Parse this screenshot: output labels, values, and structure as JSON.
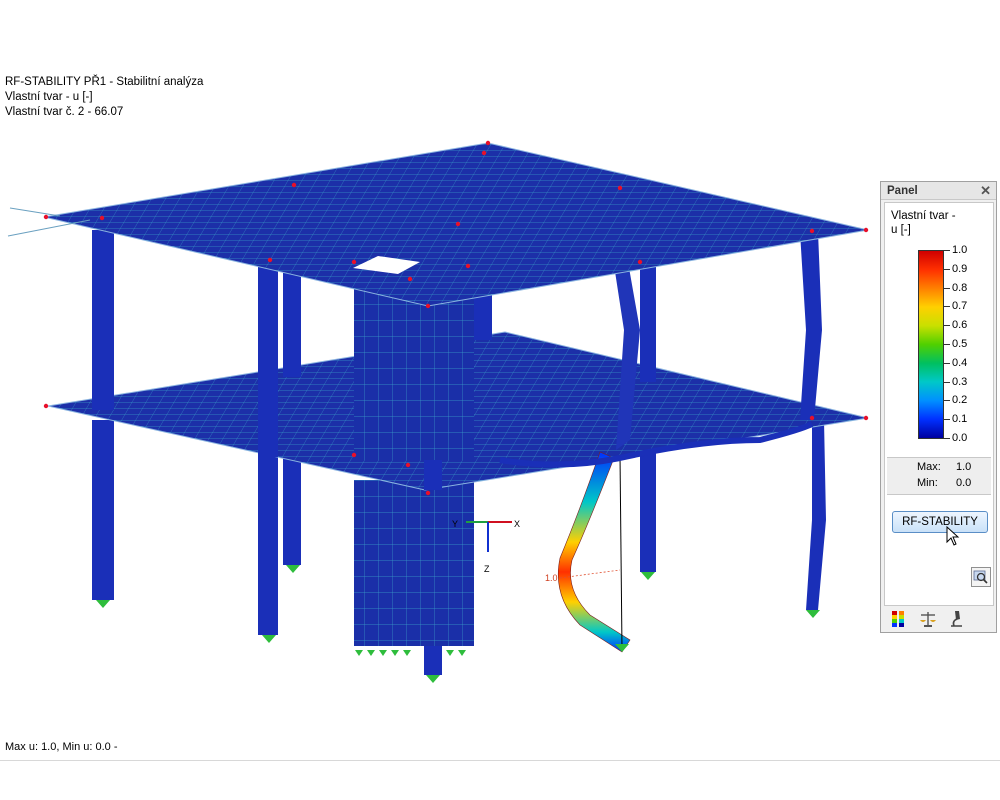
{
  "info": {
    "line1": "RF-STABILITY PŘ1 - Stabilitní analýza",
    "line2": "Vlastní tvar - u [-]",
    "line3": "Vlastní tvar č. 2  -  66.07"
  },
  "axes": {
    "x": "X",
    "y": "Y",
    "z": "Z"
  },
  "deformed_label": "1.0",
  "footer": "Max u: 1.0, Min u: 0.0 -",
  "panel": {
    "title": "Panel",
    "close": "✕",
    "quantity_line1": "Vlastní tvar -",
    "quantity_line2": "u [-]",
    "legend": [
      "1.0",
      "0.9",
      "0.8",
      "0.7",
      "0.6",
      "0.5",
      "0.4",
      "0.3",
      "0.2",
      "0.1",
      "0.0"
    ],
    "max_label": "Max:",
    "max_value": "1.0",
    "min_label": "Min:",
    "min_value": "0.0",
    "button": "RF-STABILITY"
  },
  "icons": {
    "zoom": "magnifier-icon",
    "color_scale": "color-scale-icon",
    "balance": "balance-icon",
    "microscope": "microscope-icon"
  },
  "colors": {
    "structure": "#1c2fa8",
    "member": "#1a2fb8",
    "mesh": "#3aa0c8",
    "support": "#2ebd3c",
    "node": "#e8102a",
    "legend_high": "#d00000",
    "legend_low": "#0000a0"
  }
}
